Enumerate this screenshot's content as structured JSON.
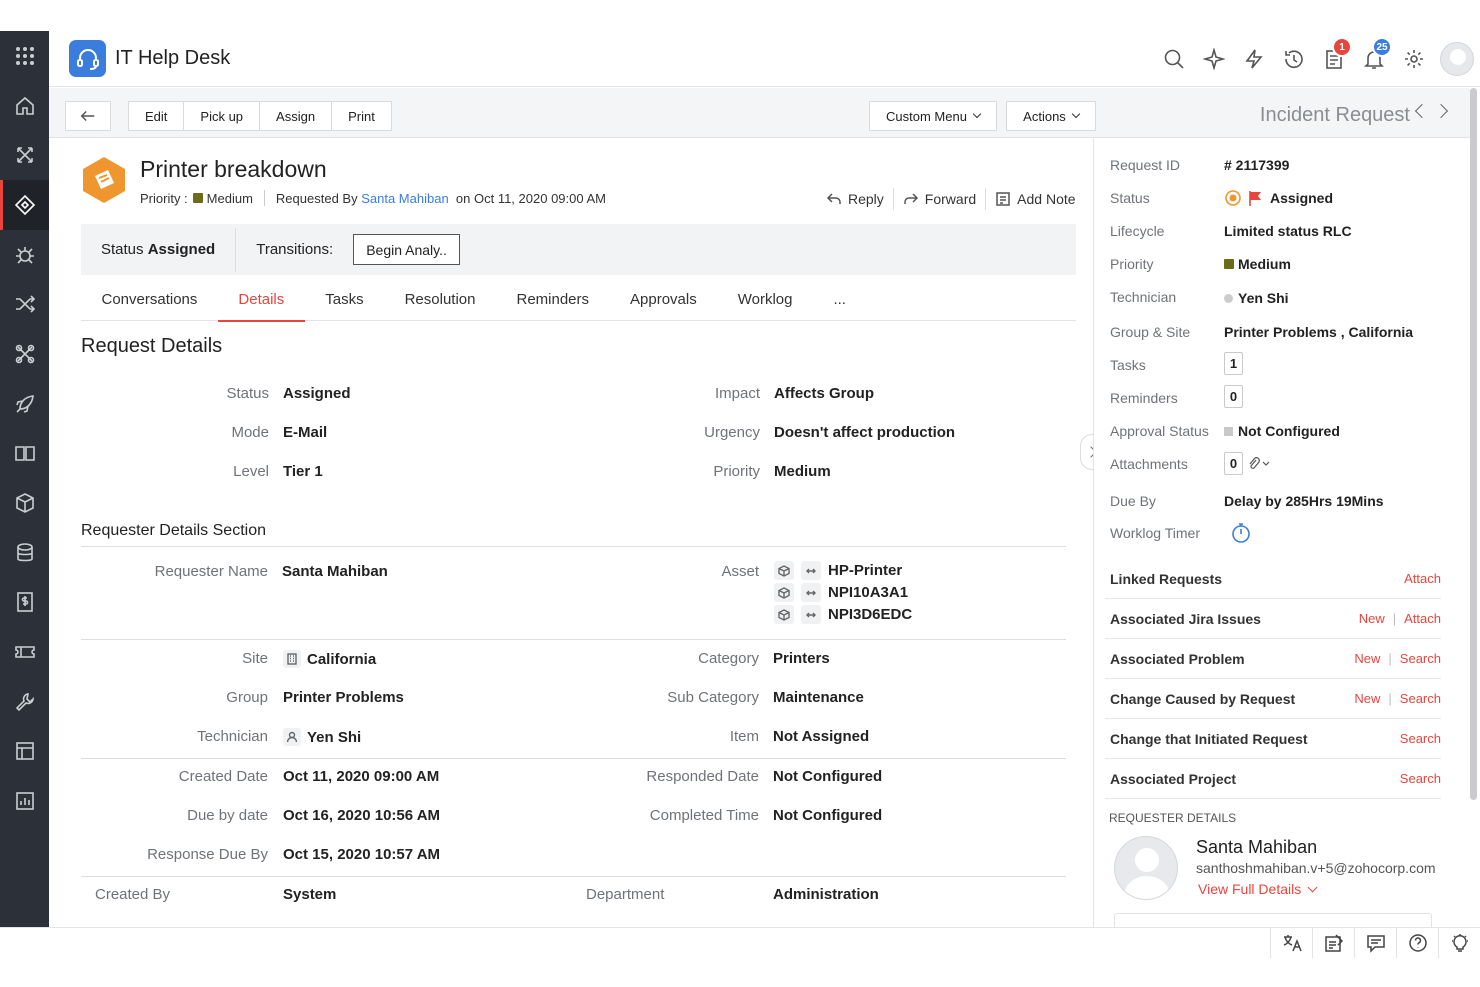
{
  "app": {
    "title": "IT Help Desk"
  },
  "header": {
    "notifications": {
      "requests_badge": "1",
      "bell_badge": "25"
    }
  },
  "toolbar": {
    "buttons": [
      "Edit",
      "Pick up",
      "Assign",
      "Print"
    ],
    "custom_menu": "Custom Menu",
    "actions": "Actions",
    "record_type": "Incident Request"
  },
  "request": {
    "title": "Printer breakdown",
    "priority_label": "Priority :",
    "priority": "Medium",
    "requested_by_label": "Requested By",
    "requested_by": "Santa Mahiban",
    "requested_on": "on Oct 11, 2020 09:00 AM",
    "actions": {
      "reply": "Reply",
      "forward": "Forward",
      "add_note": "Add Note"
    },
    "status_label": "Status",
    "status": "Assigned",
    "transitions_label": "Transitions:",
    "transition_button": "Begin Analy.."
  },
  "tabs": [
    "Conversations",
    "Details",
    "Tasks",
    "Resolution",
    "Reminders",
    "Approvals",
    "Worklog",
    "..."
  ],
  "details": {
    "section_title": "Request Details",
    "status": {
      "label": "Status",
      "value": "Assigned"
    },
    "mode": {
      "label": "Mode",
      "value": "E-Mail"
    },
    "level": {
      "label": "Level",
      "value": "Tier 1"
    },
    "impact": {
      "label": "Impact",
      "value": "Affects Group"
    },
    "urgency": {
      "label": "Urgency",
      "value": "Doesn't affect production"
    },
    "priority": {
      "label": "Priority",
      "value": "Medium"
    },
    "requester_section": "Requester Details Section",
    "requester_name": {
      "label": "Requester Name",
      "value": "Santa Mahiban"
    },
    "asset": {
      "label": "Asset",
      "values": [
        "HP-Printer",
        "NPI10A3A1",
        "NPI3D6EDC"
      ]
    },
    "site": {
      "label": "Site",
      "value": "California"
    },
    "group": {
      "label": "Group",
      "value": "Printer Problems"
    },
    "technician": {
      "label": "Technician",
      "value": "Yen Shi"
    },
    "category": {
      "label": "Category",
      "value": "Printers"
    },
    "sub_category": {
      "label": "Sub Category",
      "value": "Maintenance"
    },
    "item": {
      "label": "Item",
      "value": "Not Assigned"
    },
    "created_date": {
      "label": "Created Date",
      "value": "Oct 11, 2020 09:00 AM"
    },
    "due_by_date": {
      "label": "Due by date",
      "value": "Oct 16, 2020 10:56 AM"
    },
    "response_due_by": {
      "label": "Response Due By",
      "value": "Oct 15, 2020 10:57 AM"
    },
    "responded_date": {
      "label": "Responded Date",
      "value": "Not Configured"
    },
    "completed_time": {
      "label": "Completed Time",
      "value": "Not Configured"
    },
    "created_by": {
      "label": "Created By",
      "value": "System"
    },
    "department": {
      "label": "Department",
      "value": "Administration"
    }
  },
  "sidebar_panel": {
    "request_id": {
      "label": "Request ID",
      "value": "# 2117399"
    },
    "status": {
      "label": "Status",
      "value": "Assigned"
    },
    "lifecycle": {
      "label": "Lifecycle",
      "value": "Limited status RLC"
    },
    "priority": {
      "label": "Priority",
      "value": "Medium"
    },
    "technician": {
      "label": "Technician",
      "value": "Yen Shi"
    },
    "group_site": {
      "label": "Group & Site",
      "value": "Printer Problems , California"
    },
    "tasks": {
      "label": "Tasks",
      "value": "1"
    },
    "reminders": {
      "label": "Reminders",
      "value": "0"
    },
    "approval_status": {
      "label": "Approval Status",
      "value": "Not Configured"
    },
    "attachments": {
      "label": "Attachments",
      "value": "0"
    },
    "due_by": {
      "label": "Due By",
      "value": "Delay by 285Hrs 19Mins"
    },
    "worklog_timer": {
      "label": "Worklog Timer"
    },
    "links": [
      {
        "name": "Linked Requests",
        "actions": [
          "Attach"
        ]
      },
      {
        "name": "Associated Jira Issues",
        "actions": [
          "New",
          "Attach"
        ]
      },
      {
        "name": "Associated Problem",
        "actions": [
          "New",
          "Search"
        ]
      },
      {
        "name": "Change Caused by Request",
        "actions": [
          "New",
          "Search"
        ]
      },
      {
        "name": "Change that Initiated Request",
        "actions": [
          "Search"
        ]
      },
      {
        "name": "Associated Project",
        "actions": [
          "Search"
        ]
      }
    ],
    "requester_details_title": "REQUESTER DETAILS",
    "requester": {
      "name": "Santa Mahiban",
      "email": "santhoshmahiban.v+5@zohocorp.com",
      "view_details": "View Full Details"
    }
  },
  "colors": {
    "accent": "#e8453c",
    "brand": "#3b7ddd",
    "rail": "#2c3038",
    "priority_medium": "#6b6b1a",
    "ticket_icon": "#f0962e"
  },
  "icons": {
    "rail": [
      "apps-grid-icon",
      "home-icon",
      "requests-icon",
      "ticket-icon",
      "bug-icon",
      "shuffle-icon",
      "tools-icon",
      "rocket-icon",
      "book-icon",
      "box-icon",
      "database-icon",
      "dollar-icon",
      "ticket-alt-icon",
      "wrench-icon",
      "layout-icon",
      "report-icon"
    ],
    "header": [
      "search-icon",
      "sparkle-icon",
      "lightning-icon",
      "history-icon",
      "requests-icon",
      "bell-icon",
      "gear-icon"
    ],
    "bottom": [
      "translate-icon",
      "notes-icon",
      "chat-icon",
      "help-icon",
      "bulb-icon"
    ]
  }
}
